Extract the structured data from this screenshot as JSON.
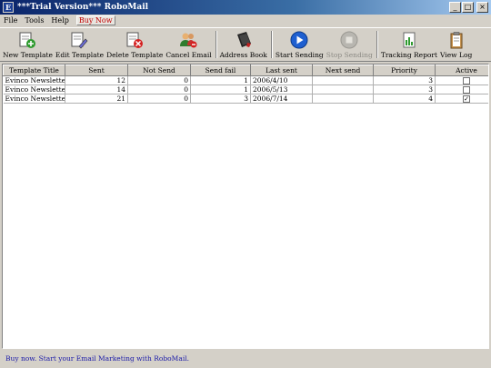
{
  "window": {
    "title": "***Trial Version*** RoboMail",
    "controls": [
      "_",
      "□",
      "×"
    ]
  },
  "menu": [
    "File",
    "Tools",
    "Help",
    "Buy Now"
  ],
  "toolbar": {
    "new_template": "New Template",
    "edit_template": "Edit Template",
    "delete_template": "Delete Template",
    "cancel_email": "Cancel Email",
    "address_book": "Address Book",
    "start_sending": "Start Sending",
    "stop_sending": "Stop Sending",
    "tracking_report": "Tracking Report",
    "view_log": "View Log"
  },
  "grid": {
    "columns": [
      "Template Title",
      "Sent",
      "Not Send",
      "Send fail",
      "Last sent",
      "Next send",
      "Priority",
      "Active"
    ],
    "rows": [
      {
        "title": "Evinco Newslette...",
        "sent": "12",
        "not_send": "0",
        "send_fail": "1",
        "last_sent": "2006/4/10",
        "next_send": "",
        "priority": "3",
        "active": false
      },
      {
        "title": "Evinco Newslette...",
        "sent": "14",
        "not_send": "0",
        "send_fail": "1",
        "last_sent": "2006/5/13",
        "next_send": "",
        "priority": "3",
        "active": false
      },
      {
        "title": "Evinco Newslette...",
        "sent": "21",
        "not_send": "0",
        "send_fail": "3",
        "last_sent": "2006/7/14",
        "next_send": "",
        "priority": "4",
        "active": true
      }
    ]
  },
  "status": "Buy now. Start your Email Marketing with RoboMail.",
  "colors": {
    "titlebar": "#0a246a",
    "face": "#d4d0c8",
    "status_text": "#1a1aa8",
    "buy_now": "#c00000"
  }
}
